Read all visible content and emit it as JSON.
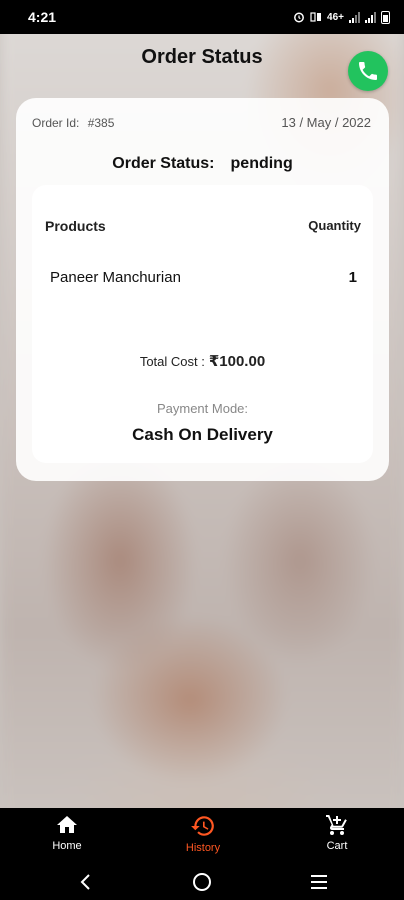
{
  "status_bar": {
    "time": "4:21",
    "network": "46+",
    "icons": [
      "alarm-icon",
      "data-icon",
      "signal-icon",
      "signal-icon",
      "battery-icon"
    ]
  },
  "header": {
    "title": "Order Status",
    "call_icon": "phone-icon",
    "call_color": "#22c35e"
  },
  "order": {
    "id_label": "Order Id:",
    "id_value": "#385",
    "date": "13 / May / 2022",
    "status_label": "Order Status:",
    "status_value": "pending",
    "products_header": "Products",
    "quantity_header": "Quantity",
    "items": [
      {
        "name": "Paneer Manchurian",
        "quantity": "1"
      }
    ],
    "total_label": "Total Cost :",
    "total_value": "₹100.00",
    "payment_label": "Payment Mode:",
    "payment_value": "Cash On Delivery"
  },
  "bottom_nav": {
    "items": [
      {
        "label": "Home",
        "icon": "home-icon",
        "active": false
      },
      {
        "label": "History",
        "icon": "history-icon",
        "active": true
      },
      {
        "label": "Cart",
        "icon": "cart-icon",
        "active": false
      }
    ],
    "active_color": "#ff5722"
  },
  "system_nav": [
    "back-icon",
    "home-circle-icon",
    "recents-icon"
  ]
}
